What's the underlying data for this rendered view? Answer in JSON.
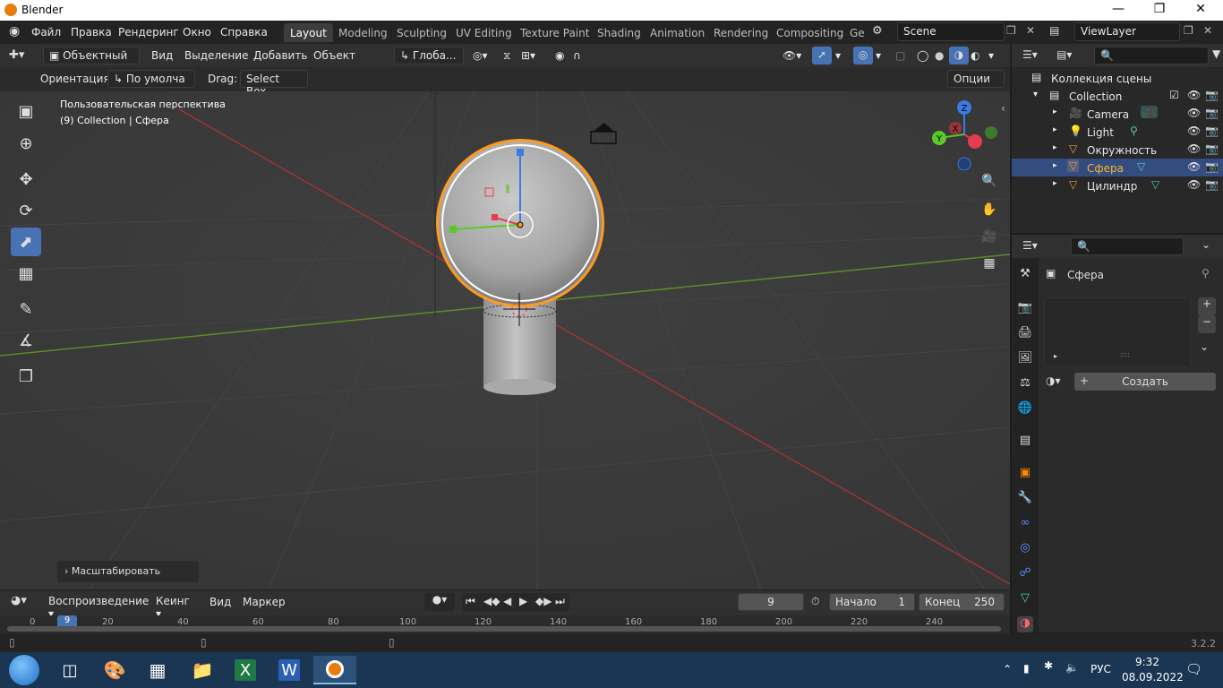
{
  "window": {
    "title": "Blender"
  },
  "menu": [
    "Файл",
    "Правка",
    "Рендеринг",
    "Окно",
    "Справка"
  ],
  "workspaces": [
    "Layout",
    "Modeling",
    "Sculpting",
    "UV Editing",
    "Texture Paint",
    "Shading",
    "Animation",
    "Rendering",
    "Compositing",
    "Ge"
  ],
  "scene": "Scene",
  "view_layer": "ViewLayer",
  "viewport_header": {
    "mode": "Объектный ...",
    "items": [
      "Вид",
      "Выделение",
      "Добавить",
      "Объект"
    ],
    "transform": "Глоба..."
  },
  "tool_header": {
    "orientation_label": "Ориентация:",
    "orientation_value": "По умолча",
    "drag_label": "Drag:",
    "drag_value": "Select Box",
    "options": "Опции"
  },
  "viewport": {
    "view_name": "Пользовательская перспектива",
    "collection_info": "(9) Collection | Сфера",
    "last_op": "Масштабировать"
  },
  "gizmo": {
    "z": "Z",
    "y": "Y",
    "x": "X"
  },
  "outliner": {
    "scene_collection": "Коллекция сцены",
    "items": [
      {
        "name": "Collection"
      },
      {
        "name": "Camera"
      },
      {
        "name": "Light"
      },
      {
        "name": "Окружность"
      },
      {
        "name": "Сфера"
      },
      {
        "name": "Цилиндр"
      }
    ]
  },
  "properties": {
    "object_name": "Сфера",
    "create_button": "Создать"
  },
  "timeline": {
    "playback": "Воспроизведение",
    "keying": "Кеинг",
    "view": "Вид",
    "marker": "Маркер",
    "current_frame": "9",
    "start_label": "Начало",
    "start_value": "1",
    "end_label": "Конец",
    "end_value": "250",
    "ruler": [
      "0",
      "20",
      "40",
      "60",
      "80",
      "100",
      "120",
      "140",
      "160",
      "180",
      "200",
      "220",
      "240"
    ],
    "ruler_current": "9"
  },
  "status": {
    "version": "3.2.2"
  },
  "taskbar": {
    "lang": "РУС",
    "time": "9:32",
    "date": "08.09.2022"
  },
  "colors": {
    "accent": "#4772b3",
    "selected": "#ff9a20",
    "blender_orange": "#e87d0d"
  }
}
